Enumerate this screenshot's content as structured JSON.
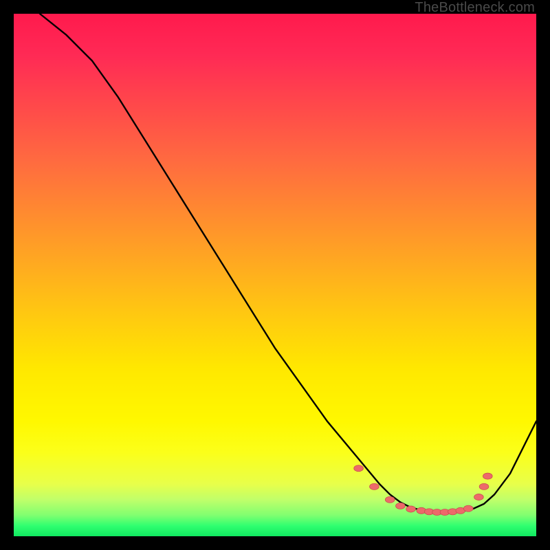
{
  "watermark": "TheBottleneck.com",
  "colors": {
    "marker_fill": "#ed6a6a",
    "marker_stroke": "#c94f4f",
    "curve_stroke": "#000000"
  },
  "chart_data": {
    "type": "line",
    "title": "",
    "xlabel": "",
    "ylabel": "",
    "xlim": [
      0,
      100
    ],
    "ylim": [
      0,
      100
    ],
    "grid": false,
    "legend": false,
    "note": "Chart has no visible numeric axes or ticks; x/y are normalized 0-100. y represents bottleneck % (top=100, bottom=0). Curve descends steeply from upper-left, flattens near bottom around x≈70-88, then rises toward the right edge.",
    "series": [
      {
        "name": "bottleneck-curve",
        "x": [
          5,
          10,
          15,
          20,
          25,
          30,
          35,
          40,
          45,
          50,
          55,
          60,
          65,
          70,
          72,
          74,
          76,
          78,
          80,
          82,
          84,
          86,
          88,
          90,
          92,
          95,
          98,
          100
        ],
        "y": [
          100,
          96,
          91,
          84,
          76,
          68,
          60,
          52,
          44,
          36,
          29,
          22,
          16,
          10,
          8,
          6.5,
          5.5,
          5,
          4.7,
          4.6,
          4.6,
          4.8,
          5.3,
          6.2,
          8,
          12,
          18,
          22
        ]
      }
    ],
    "markers": {
      "name": "highlight-dots",
      "shape": "ellipse",
      "rx": 0.9,
      "ry": 0.6,
      "points": [
        {
          "x": 66,
          "y": 13
        },
        {
          "x": 69,
          "y": 9.5
        },
        {
          "x": 72,
          "y": 7
        },
        {
          "x": 74,
          "y": 5.8
        },
        {
          "x": 76,
          "y": 5.2
        },
        {
          "x": 78,
          "y": 4.9
        },
        {
          "x": 79.5,
          "y": 4.7
        },
        {
          "x": 81,
          "y": 4.6
        },
        {
          "x": 82.5,
          "y": 4.6
        },
        {
          "x": 84,
          "y": 4.7
        },
        {
          "x": 85.5,
          "y": 4.9
        },
        {
          "x": 87,
          "y": 5.3
        },
        {
          "x": 89,
          "y": 7.5
        },
        {
          "x": 90,
          "y": 9.5
        },
        {
          "x": 90.7,
          "y": 11.5
        }
      ]
    }
  }
}
